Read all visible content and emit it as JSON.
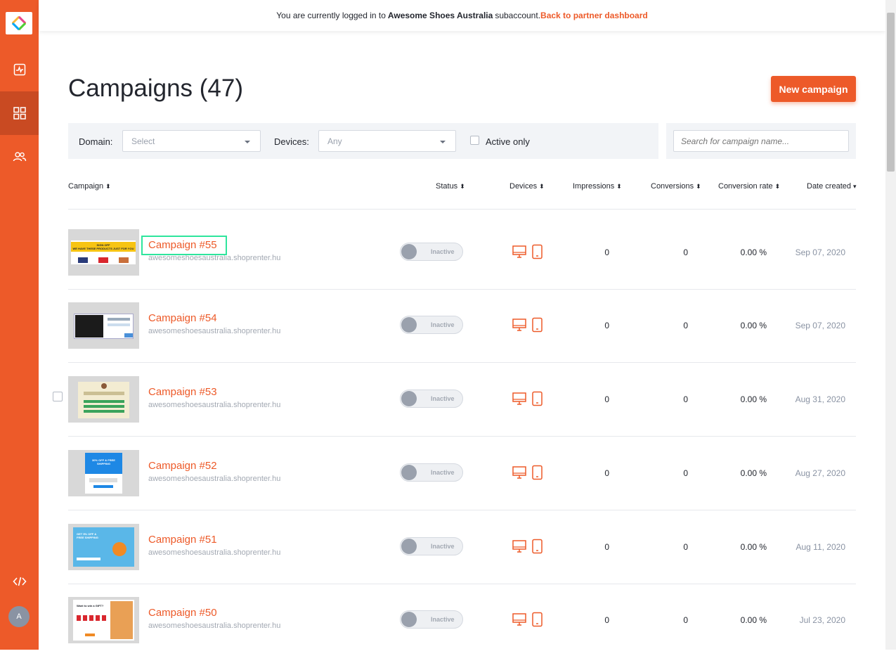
{
  "topbar": {
    "prefix": "You are currently logged in to",
    "account": "Awesome Shoes Australia",
    "suffix": "subaccount.",
    "back_link": "Back to partner dashboard"
  },
  "sidebar": {
    "items": [
      {
        "name": "analytics-icon"
      },
      {
        "name": "campaigns-grid-icon",
        "active": true
      },
      {
        "name": "users-icon"
      }
    ],
    "bottom_icon": "code-icon",
    "avatar_initial": "A"
  },
  "page": {
    "title": "Campaigns (47)",
    "new_campaign": "New campaign"
  },
  "filters": {
    "domain_label": "Domain:",
    "domain_value": "Select",
    "devices_label": "Devices:",
    "devices_value": "Any",
    "active_only": "Active only",
    "search_placeholder": "Search for campaign name..."
  },
  "table": {
    "headers": [
      "Campaign",
      "Status",
      "Devices",
      "Impressions",
      "Conversions",
      "Conversion rate",
      "Date created"
    ],
    "rows": [
      {
        "name": "Campaign #55",
        "domain": "awesomeshoesaustralia.shoprenter.hu",
        "status": "Inactive",
        "impressions": "0",
        "conversions": "0",
        "rate": "0.00 %",
        "date": "Sep 07, 2020"
      },
      {
        "name": "Campaign #54",
        "domain": "awesomeshoesaustralia.shoprenter.hu",
        "status": "Inactive",
        "impressions": "0",
        "conversions": "0",
        "rate": "0.00 %",
        "date": "Sep 07, 2020"
      },
      {
        "name": "Campaign #53",
        "domain": "awesomeshoesaustralia.shoprenter.hu",
        "status": "Inactive",
        "impressions": "0",
        "conversions": "0",
        "rate": "0.00 %",
        "date": "Aug 31, 2020"
      },
      {
        "name": "Campaign #52",
        "domain": "awesomeshoesaustralia.shoprenter.hu",
        "status": "Inactive",
        "impressions": "0",
        "conversions": "0",
        "rate": "0.00 %",
        "date": "Aug 27, 2020"
      },
      {
        "name": "Campaign #51",
        "domain": "awesomeshoesaustralia.shoprenter.hu",
        "status": "Inactive",
        "impressions": "0",
        "conversions": "0",
        "rate": "0.00 %",
        "date": "Aug 11, 2020"
      },
      {
        "name": "Campaign #50",
        "domain": "awesomeshoesaustralia.shoprenter.hu",
        "status": "Inactive",
        "impressions": "0",
        "conversions": "0",
        "rate": "0.00 %",
        "date": "Jul 23, 2020"
      }
    ]
  },
  "thumbnails": {
    "t55_title": "SIGN OFF",
    "t55_text": "WE HAVE THESE PRODUCTS JUST FOR YOU",
    "t52_text": "30% OFF & FREE SHIPPING",
    "t51_text": "GET 5% OFF & FREE SHIPPING",
    "t50_text": "Want to win a GIFT?"
  },
  "colors": {
    "accent": "#ed5a29",
    "accent_dark": "#c94a22",
    "highlight": "#2ee59d"
  }
}
